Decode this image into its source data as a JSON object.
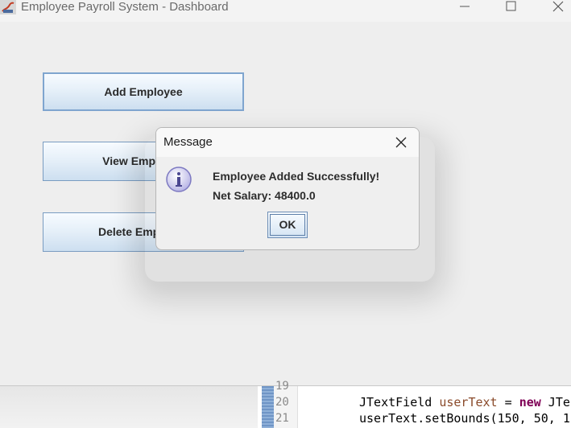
{
  "window": {
    "title": "Employee Payroll System - Dashboard",
    "controls": [
      "minimize-icon",
      "maximize-icon",
      "close-icon"
    ]
  },
  "main": {
    "buttons": [
      {
        "label": "Add Employee"
      },
      {
        "label": "View Employee"
      },
      {
        "label": "Delete Employee"
      }
    ]
  },
  "dialog": {
    "title": "Message",
    "icon": "info-icon",
    "message_line1": "Employee Added Successfully!",
    "message_line2": "Net Salary: 48400.0",
    "ok_label": "OK"
  },
  "editor": {
    "lines": [
      {
        "number": "19",
        "code": ""
      },
      {
        "number": "20",
        "code": "JTextField userText = new JTe"
      },
      {
        "number": "21",
        "code": "userText.setBounds(150, 50, 1"
      }
    ]
  },
  "colors": {
    "button_border": "#7a9cc1",
    "window_bg": "#eeeeee",
    "keyword": "#7f0055"
  }
}
